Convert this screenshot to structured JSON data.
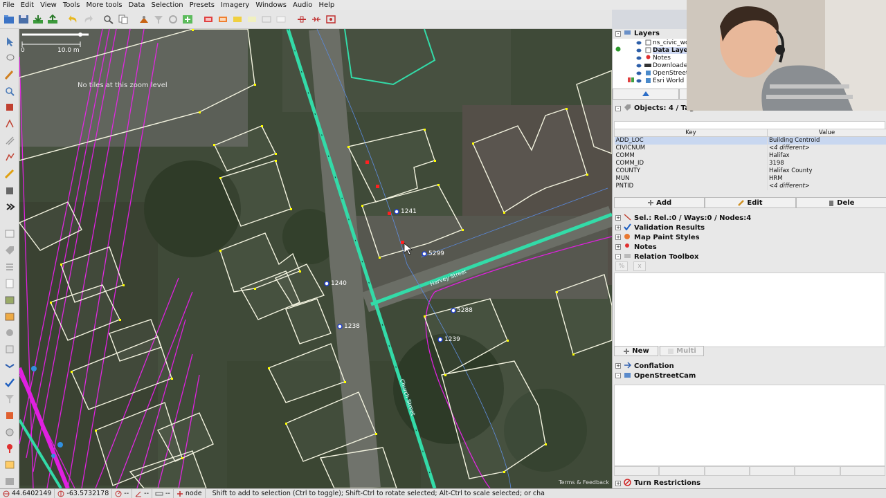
{
  "menu": [
    "File",
    "Edit",
    "View",
    "Tools",
    "More tools",
    "Data",
    "Selection",
    "Presets",
    "Imagery",
    "Windows",
    "Audio",
    "Help"
  ],
  "map": {
    "scale": {
      "start": "0",
      "end": "10.0 m"
    },
    "no_tiles_message": "No tiles at this zoom level",
    "address_labels": [
      "1241",
      "5299",
      "1240",
      "1238",
      "5288",
      "1239"
    ],
    "street_labels": [
      "Harvey Street",
      "Church Street"
    ],
    "attribution": "Terms & Feedback"
  },
  "layers_panel": {
    "title": "Layers",
    "layers": [
      {
        "name": "ns_civic_wo",
        "icon": "data-layer-icon",
        "active": false
      },
      {
        "name": "Data Layer",
        "icon": "data-layer-icon",
        "active": true
      },
      {
        "name": "Notes",
        "icon": "notes-pin-icon",
        "active": false
      },
      {
        "name": "Downloade",
        "icon": "gpx-icon",
        "active": false
      },
      {
        "name": "OpenStreet",
        "icon": "imagery-icon",
        "active": false
      },
      {
        "name": "Esri World",
        "icon": "imagery-icon",
        "active": false
      }
    ]
  },
  "objects_panel": {
    "title": "Objects: 4 / Tag",
    "columns": {
      "key": "Key",
      "value": "Value"
    },
    "rows": [
      {
        "key": "ADD_LOC",
        "value": "Building Centroid",
        "selected": true,
        "diff": false
      },
      {
        "key": "CIVICNUM",
        "value": "<4 different>",
        "selected": false,
        "diff": true
      },
      {
        "key": "COMM",
        "value": "Halifax",
        "selected": false,
        "diff": false
      },
      {
        "key": "COMM_ID",
        "value": "3198",
        "selected": false,
        "diff": false
      },
      {
        "key": "COUNTY",
        "value": "Halifax County",
        "selected": false,
        "diff": false
      },
      {
        "key": "MUN",
        "value": "HRM",
        "selected": false,
        "diff": false
      },
      {
        "key": "PNTID",
        "value": "<4 different>",
        "selected": false,
        "diff": true
      }
    ],
    "buttons": {
      "add": "Add",
      "edit": "Edit",
      "delete": "Dele"
    }
  },
  "selection_summary": "Sel.: Rel.:0 / Ways:0 / Nodes:4",
  "dialogs": [
    "Validation Results",
    "Map Paint Styles",
    "Notes",
    "Relation Toolbox"
  ],
  "relation_buttons": {
    "new": "New",
    "multi": "Multi"
  },
  "plugins": [
    "Conflation",
    "OpenStreetCam"
  ],
  "turn_restrictions": "Turn Restrictions",
  "status": {
    "lat": "44.6402149",
    "lon": "-63.5732178",
    "heading": "--",
    "angle": "--",
    "distance": "--",
    "mode": "node",
    "hint": "Shift to add to selection (Ctrl to toggle); Shift-Ctrl to rotate selected; Alt-Ctrl to scale selected; or cha"
  },
  "colors": {
    "building_outline": "#f4f4e0",
    "vertex": "#ffff00",
    "road": "#33dba8",
    "gpx_track": "#e020e0",
    "selected_node": "#ff2020"
  }
}
